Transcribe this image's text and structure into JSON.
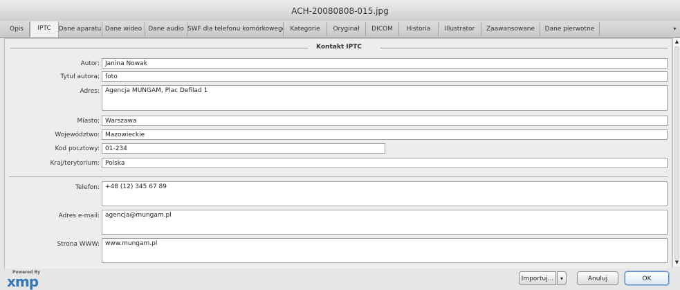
{
  "window": {
    "title": "ACH-20080808-015.jpg"
  },
  "tabs": [
    "Opis",
    "IPTC",
    "Dane aparatu",
    "Dane wideo",
    "Dane audio",
    "SWF dla telefonu komórkowego",
    "Kategorie",
    "Oryginał",
    "DICOM",
    "Historia",
    "Illustrator",
    "Zaawansowane",
    "Dane pierwotne"
  ],
  "active_tab": "IPTC",
  "tab_scroll_icon": "▾",
  "section": {
    "title": "Kontakt IPTC"
  },
  "fields": {
    "autor": {
      "label": "Autor:",
      "value": "Janina Nowak"
    },
    "tytul_autora": {
      "label": "Tytuł autora:",
      "value": "foto"
    },
    "adres": {
      "label": "Adres:",
      "value": "Agencja MUNGAM, Plac Defilad 1"
    },
    "miasto": {
      "label": "Miasto:",
      "value": "Warszawa"
    },
    "wojewodztwo": {
      "label": "Województwo:",
      "value": "Mazowieckie"
    },
    "kod_pocztowy": {
      "label": "Kod pocztowy:",
      "value": "01-234"
    },
    "kraj": {
      "label": "Kraj/terytorium:",
      "value": "Polska"
    },
    "telefon": {
      "label": "Telefon:",
      "value": "+48 (12) 345 67 89"
    },
    "email": {
      "label": "Adres e-mail:",
      "value": "agencja@mungam.pl"
    },
    "www": {
      "label": "Strona WWW:",
      "value": "www.mungam.pl"
    }
  },
  "footer": {
    "logo_powered": "Powered By",
    "logo_text": "xmp",
    "import_label": "Importuj...",
    "import_arrow": "▾",
    "cancel_label": "Anuluj",
    "ok_label": "OK"
  },
  "scrollbar": {
    "up_icon": "▲",
    "down_icon": "▼"
  },
  "colors": {
    "accent": "#3478b8",
    "ok_border": "#5b86c2"
  }
}
